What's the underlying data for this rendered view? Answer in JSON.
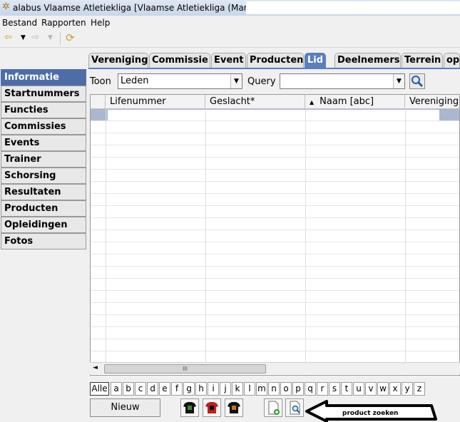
{
  "window": {
    "title": "alabus Vlaamse Atletiekliga [Vlaamse Atletiekliga (Mandant)]"
  },
  "menu": {
    "items": [
      "Bestand",
      "Rapporten",
      "Help"
    ]
  },
  "sidebar": {
    "items": [
      "Informatie",
      "Startnummers",
      "Functies",
      "Commissies",
      "Events",
      "Trainer",
      "Schorsing",
      "Resultaten",
      "Producten",
      "Opleidingen",
      "Fotos"
    ],
    "selected": "Informatie"
  },
  "tabs": {
    "items": [
      "Vereniging",
      "Commissie",
      "Event",
      "Producten",
      "Lid",
      "Deelnemers",
      "Terrein",
      "op"
    ],
    "active": "Lid"
  },
  "filter": {
    "toon_label": "Toon",
    "toon_value": "Leden",
    "query_label": "Query",
    "query_value": ""
  },
  "grid": {
    "columns": [
      "Lifenummer",
      "Geslacht*",
      "Naam [abc]",
      "Vereniging"
    ],
    "sorted_column": "Naam [abc]",
    "scroll_thumb": "III"
  },
  "alphabet": [
    "Alle",
    "a",
    "b",
    "c",
    "d",
    "e",
    "f",
    "g",
    "h",
    "i",
    "j",
    "k",
    "l",
    "m",
    "n",
    "o",
    "p",
    "q",
    "r",
    "s",
    "t",
    "u",
    "v",
    "w",
    "x",
    "y",
    "z"
  ],
  "buttons": {
    "new_label": "Nieuw"
  },
  "annotation": {
    "text": "product zoeken"
  },
  "colors": {
    "accent": "#5b7fbe",
    "sidebar_selected": "#4e6da8",
    "row_selected": "#a9b7d1"
  }
}
